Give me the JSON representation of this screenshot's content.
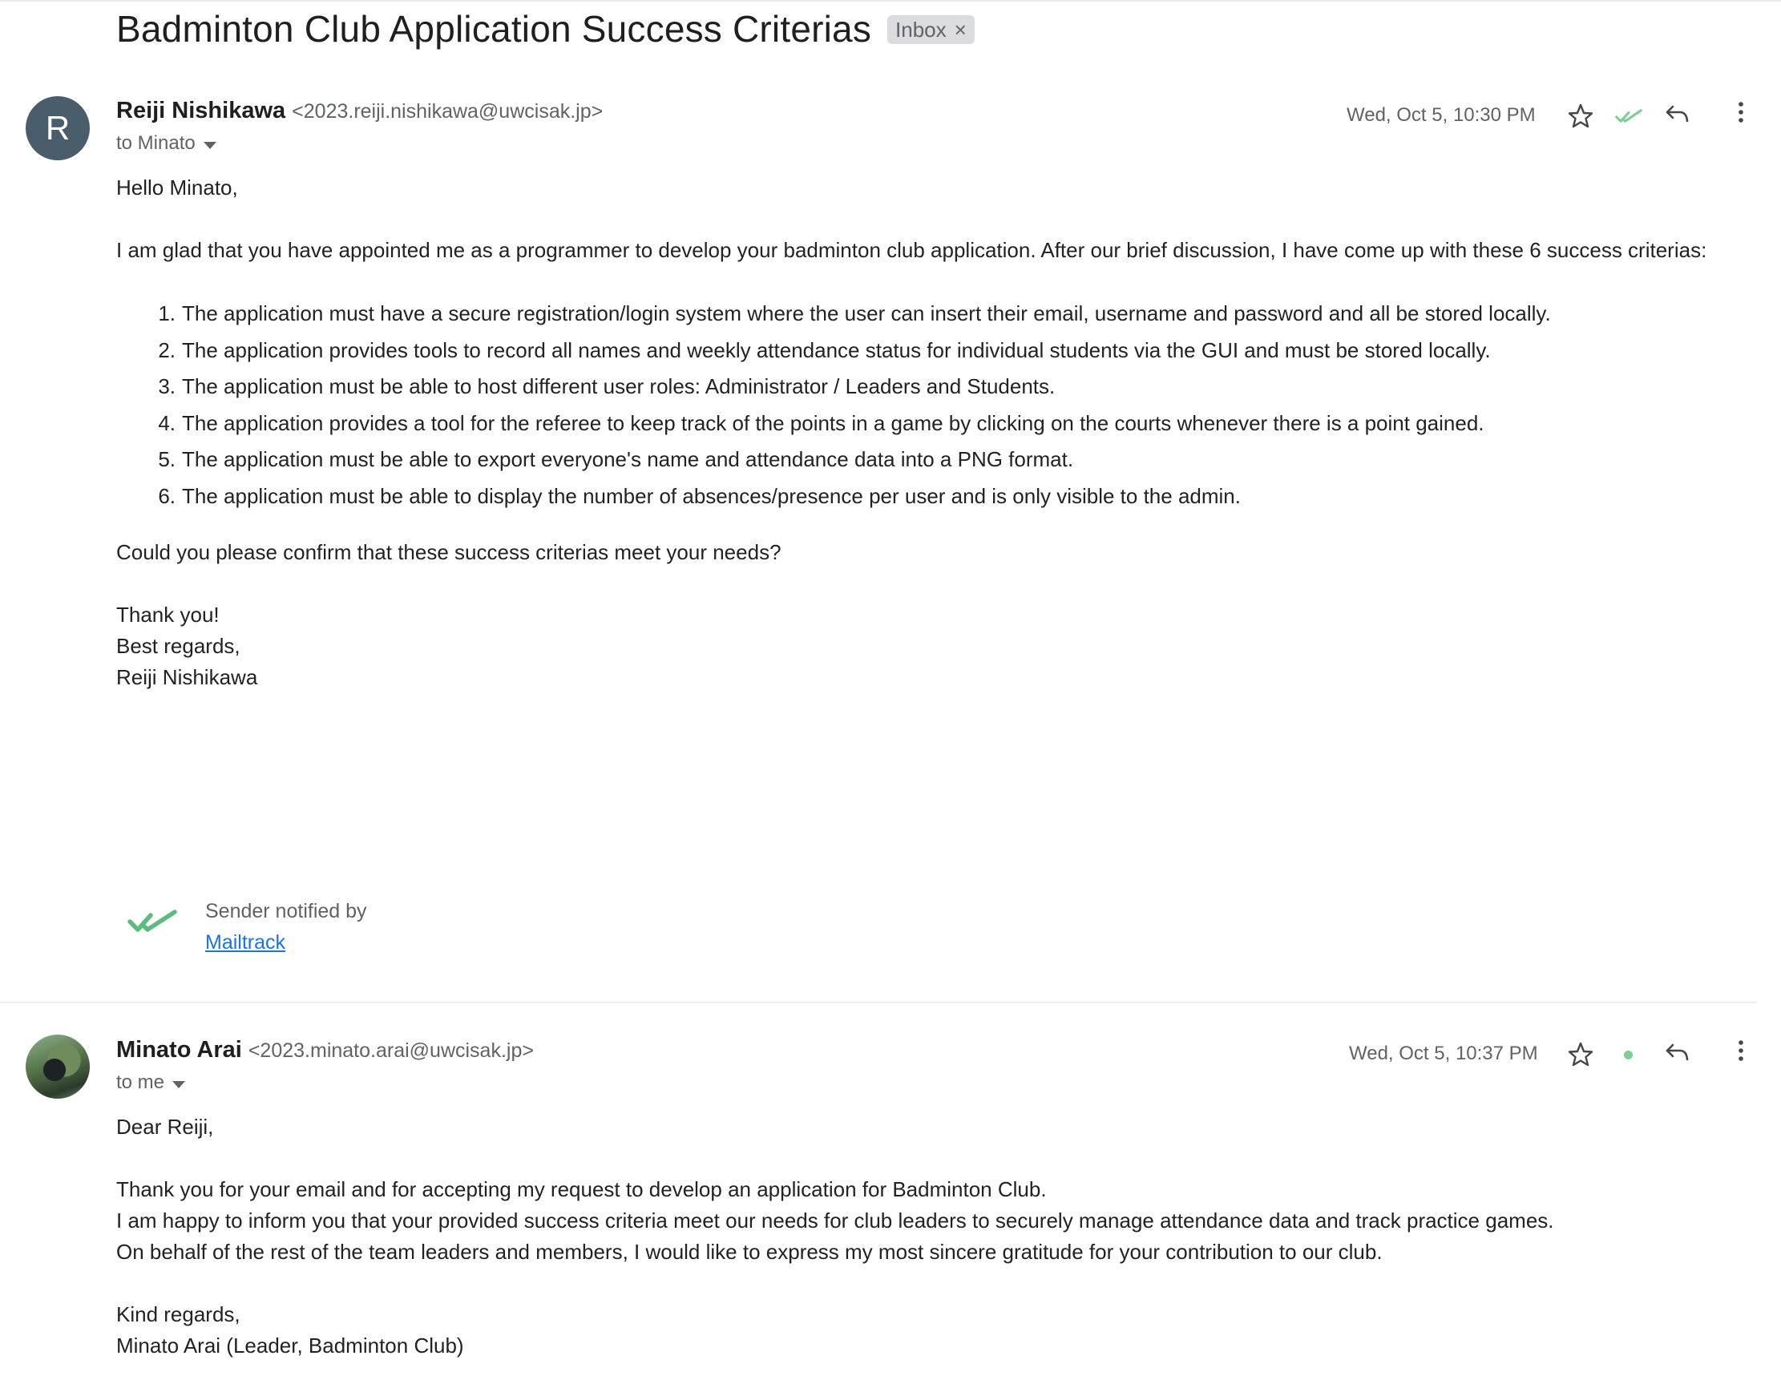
{
  "thread": {
    "subject": "Badminton Club Application Success Criterias",
    "label": "Inbox",
    "label_remove": "×"
  },
  "top_actions": [
    {
      "name": "forward-all-icon"
    },
    {
      "name": "collapse-all-icon"
    },
    {
      "name": "print-icon"
    },
    {
      "name": "open-in-new-window-icon"
    }
  ],
  "message1": {
    "avatar_letter": "R",
    "avatar_color": "#4a5d6b",
    "sender_name": "Reiji Nishikawa",
    "sender_email": "<2023.reiji.nishikawa@uwcisak.jp>",
    "to": "to Minato",
    "date": "Wed, Oct 5, 10:30 PM",
    "greeting": "Hello Minato,",
    "intro": "I am glad that you have appointed me as a programmer to develop your badminton club application. After our brief discussion, I have come up with these 6 success criterias:",
    "criteria": [
      {
        "num": "1.",
        "text": "The application must have a secure registration/login system where the user can insert their email, username and password and all be stored locally."
      },
      {
        "num": "2.",
        "text": "The application provides tools to record all names and weekly attendance status for individual students via the GUI and must be stored locally."
      },
      {
        "num": "3.",
        "text": "The application must be able to host different user roles: Administrator / Leaders and Students."
      },
      {
        "num": "4.",
        "text": "The application provides a tool for the referee to keep track of the points in a game by clicking on the courts whenever there is a point gained."
      },
      {
        "num": "5.",
        "text": "The application must be able to export everyone's name and attendance data into a PNG format."
      },
      {
        "num": "6.",
        "text": "The application must be able to display the number of absences/presence per user and is only visible to the admin."
      }
    ],
    "question": "Could you please confirm that these success criterias meet your needs?",
    "closing1": "Thank you!",
    "closing2": "Best regards,",
    "closing3": "Reiji Nishikawa",
    "mailtrack_note": "Sender notified by",
    "mailtrack_link": "Mailtrack"
  },
  "message2": {
    "sender_name": "Minato Arai",
    "sender_email": "<2023.minato.arai@uwcisak.jp>",
    "to": "to me",
    "date": "Wed, Oct 5, 10:37 PM",
    "greeting": "Dear Reiji,",
    "line1": "Thank you for your email and for accepting my request to develop an application for Badminton Club.",
    "line2": "I am happy to inform you that your provided success criteria meet our needs for club leaders to securely manage attendance data and track practice games.",
    "line3": "On behalf of the rest of the team leaders and members, I would like to express my most sincere gratitude for your contribution to our club.",
    "closing1": "Kind regards,",
    "closing2": "Minato Arai (Leader, Badminton Club)"
  },
  "colors": {
    "mailtrack_green": "#5dbb7e",
    "link_blue": "#1a73e8",
    "chip_bg": "#dadce0"
  }
}
